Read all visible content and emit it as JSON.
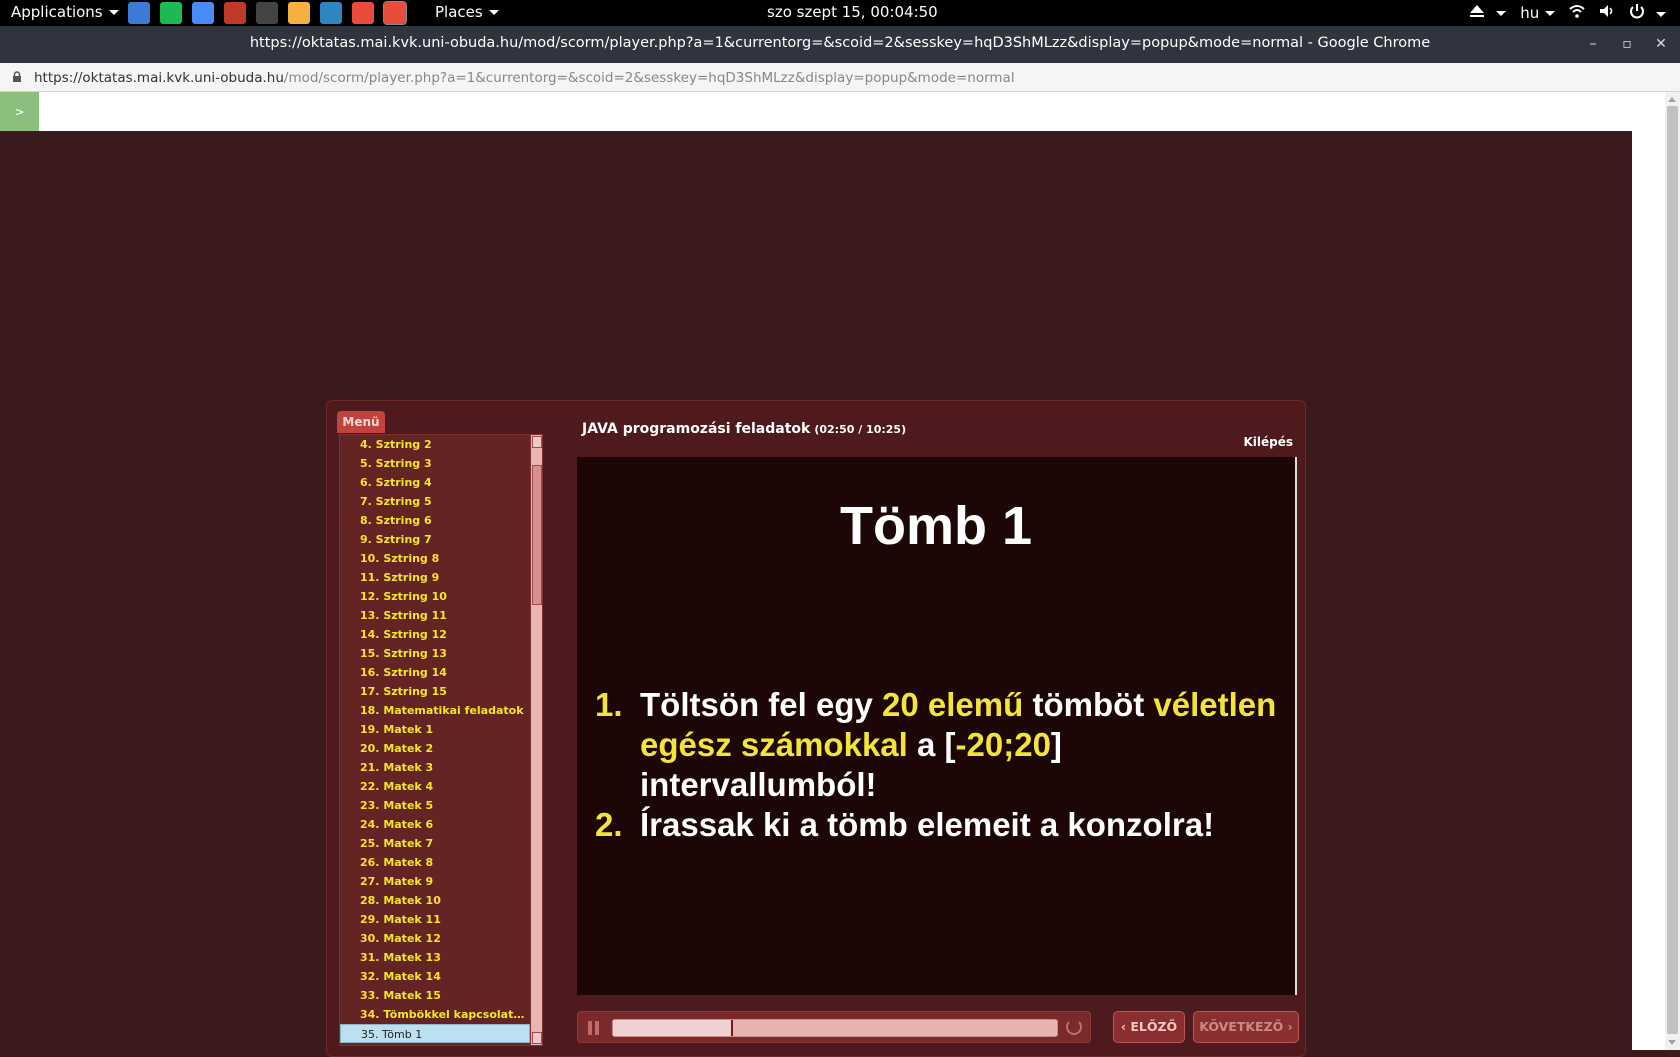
{
  "topbar": {
    "applications_label": "Applications",
    "places_label": "Places",
    "clock": "szo szept 15, 00:04:50",
    "keyboard_layout": "hu",
    "launchers": [
      {
        "name": "desktop-icon",
        "color": "#3a7bd5"
      },
      {
        "name": "spotify-icon",
        "color": "#1db954"
      },
      {
        "name": "chromium-icon",
        "color": "#4a8af4"
      },
      {
        "name": "archive-icon",
        "color": "#c0392b"
      },
      {
        "name": "terminal-icon",
        "color": "#444"
      },
      {
        "name": "text-editor-icon",
        "color": "#f5b041"
      },
      {
        "name": "system-monitor-icon",
        "color": "#2e86c1"
      },
      {
        "name": "chrome-icon",
        "color": "#e74c3c"
      },
      {
        "name": "chrome-active-icon",
        "color": "#e74c3c"
      }
    ]
  },
  "window": {
    "title": "https://oktatas.mai.kvk.uni-obuda.hu/mod/scorm/player.php?a=1&currentorg=&scoid=2&sesskey=hqD3ShMLzz&display=popup&mode=normal - Google Chrome"
  },
  "urlbar": {
    "host": "https://oktatas.mai.kvk.uni-obuda.hu",
    "path": "/mod/scorm/player.php?a=1&currentorg=&scoid=2&sesskey=hqD3ShMLzz&display=popup&mode=normal"
  },
  "toc_toggle_label": ">",
  "player": {
    "menu_tab": "Menü",
    "title": "JAVA programozási feladatok",
    "time": "(02:50 / 10:25)",
    "exit": "Kilépés",
    "prev": "ELŐZŐ",
    "next": "KÖVETKEZŐ",
    "progress_fraction": 0.27,
    "menu_items": [
      "4. Sztring 2",
      "5. Sztring 3",
      "6. Sztring  4",
      "7. Sztring 5",
      "8. Sztring 6",
      "9. Sztring 7",
      "10. Sztring 8",
      "11. Sztring 9",
      "12. Sztring 10",
      "13. Sztring 11",
      "14. Sztring 12",
      "15. Sztring 13",
      "16. Sztring 14",
      "17. Sztring 15",
      "18. Matematikai feladatok",
      "19. Matek 1",
      "20. Matek 2",
      "21. Matek 3",
      "22. Matek 4",
      "23. Matek 5",
      "24. Matek 6",
      "25. Matek 7",
      "26. Matek 8",
      "27. Matek 9",
      "28. Matek 10",
      "29. Matek 11",
      "30. Matek 12",
      "31. Matek 13",
      "32. Matek 14",
      "33. Matek 15",
      "34. Tömbökkel kapcsolatos f...",
      "35. Tömb 1"
    ],
    "selected_index": 31
  },
  "slide": {
    "title": "Tömb 1",
    "item1": {
      "num": "1.",
      "t1": "Töltsön fel egy ",
      "h1": "20 elemű",
      "t2": " tömböt ",
      "h2": "véletlen egész számokkal",
      "t3": " a ",
      "t4": "[",
      "h3": "-20;20",
      "t5": "]",
      "t6": " intervallumból!"
    },
    "item2": {
      "num": "2.",
      "text": "Írassak ki a tömb elemeit a konzolra!"
    }
  }
}
